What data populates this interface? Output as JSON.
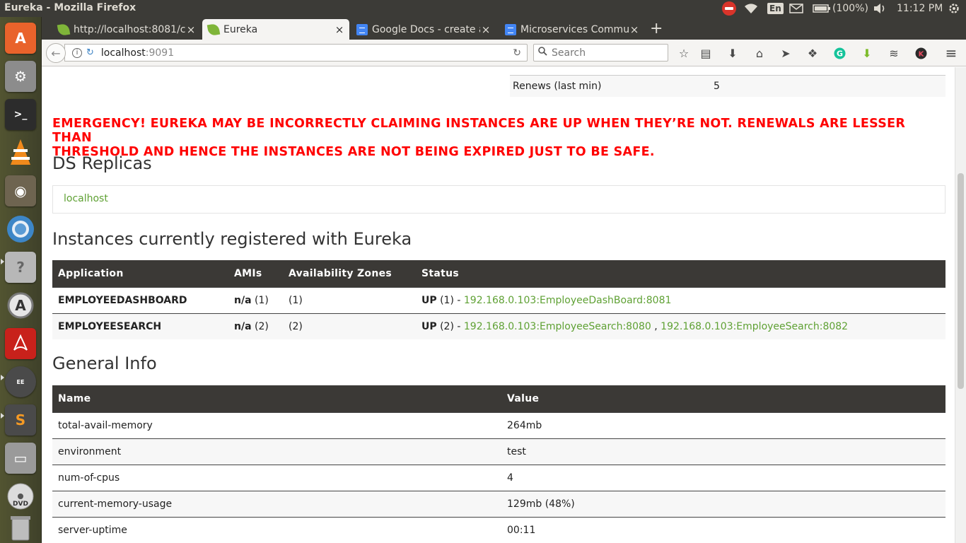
{
  "system": {
    "window_title": "Eureka - Mozilla Firefox",
    "keyboard": "En",
    "battery": "(100%)",
    "time": "11:12 PM"
  },
  "launcher": {
    "icons": [
      "ubuntu-software-icon",
      "system-settings-icon",
      "terminal-icon",
      "vlc-icon",
      "gimp-icon",
      "chromium-icon",
      "help-icon",
      "software-updater-icon",
      "acrobat-icon",
      "java-ee-ide-icon",
      "sublime-text-icon",
      "disk-icon",
      "dvd-icon",
      "trash-icon"
    ]
  },
  "tabs": [
    {
      "label": "http://localhost:8081/c",
      "icon": "spring-leaf-icon"
    },
    {
      "label": "Eureka",
      "icon": "spring-leaf-icon"
    },
    {
      "label": "Google Docs - create ar",
      "icon": "google-docs-icon"
    },
    {
      "label": "Microservices Commun",
      "icon": "google-docs-icon"
    }
  ],
  "nav": {
    "url_host": "localhost",
    "url_port": ":9091",
    "search_placeholder": "Search"
  },
  "status_rows": {
    "renews_label": "Renews (last min)",
    "renews_value": "5"
  },
  "emergency": {
    "line1": "EMERGENCY! EUREKA MAY BE INCORRECTLY CLAIMING INSTANCES ARE UP WHEN THEY’RE NOT. RENEWALS ARE LESSER THAN",
    "line2": "THRESHOLD AND HENCE THE INSTANCES ARE NOT BEING EXPIRED JUST TO BE SAFE."
  },
  "replicas": {
    "heading": "DS Replicas",
    "items": [
      "localhost"
    ]
  },
  "instances": {
    "heading": "Instances currently registered with Eureka",
    "headers": [
      "Application",
      "AMIs",
      "Availability Zones",
      "Status"
    ],
    "rows": [
      {
        "app": "EMPLOYEEDASHBOARD",
        "ami": "n/a",
        "ami_count": "(1)",
        "zones": "(1)",
        "status": "UP",
        "status_count": "(1) -",
        "links": [
          "192.168.0.103:EmployeeDashBoard:8081"
        ]
      },
      {
        "app": "EMPLOYEESEARCH",
        "ami": "n/a",
        "ami_count": "(2)",
        "zones": "(2)",
        "status": "UP",
        "status_count": "(2) -",
        "links": [
          "192.168.0.103:EmployeeSearch:8080",
          "192.168.0.103:EmployeeSearch:8082"
        ],
        "link_sep": ","
      }
    ]
  },
  "general": {
    "heading": "General Info",
    "headers": [
      "Name",
      "Value"
    ],
    "rows": [
      {
        "name": "total-avail-memory",
        "value": "264mb"
      },
      {
        "name": "environment",
        "value": "test"
      },
      {
        "name": "num-of-cpus",
        "value": "4"
      },
      {
        "name": "current-memory-usage",
        "value": "129mb (48%)"
      },
      {
        "name": "server-uptime",
        "value": "00:11"
      }
    ]
  }
}
